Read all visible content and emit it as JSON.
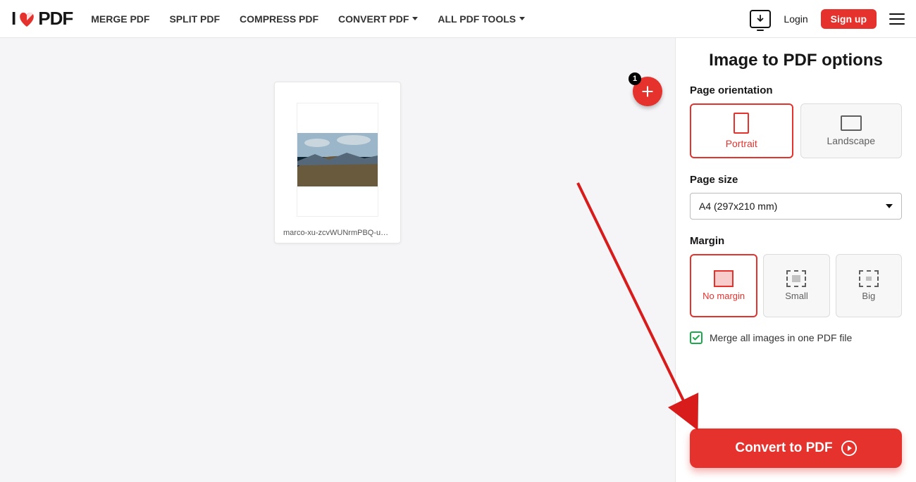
{
  "header": {
    "logo_left": "I",
    "logo_right": "PDF",
    "nav": {
      "merge": "MERGE PDF",
      "split": "SPLIT PDF",
      "compress": "COMPRESS PDF",
      "convert": "CONVERT PDF",
      "all": "ALL PDF TOOLS"
    },
    "login": "Login",
    "signup": "Sign up"
  },
  "workspace": {
    "add_badge": "1",
    "file_caption": "marco-xu-zcvWUNrmPBQ-unsp..."
  },
  "sidebar": {
    "title": "Image to PDF options",
    "orientation": {
      "label": "Page orientation",
      "portrait": "Portrait",
      "landscape": "Landscape",
      "selected": "portrait"
    },
    "page_size": {
      "label": "Page size",
      "value": "A4 (297x210 mm)"
    },
    "margin": {
      "label": "Margin",
      "none": "No margin",
      "small": "Small",
      "big": "Big",
      "selected": "none"
    },
    "merge": {
      "label": "Merge all images in one PDF file",
      "checked": true
    },
    "cta": "Convert to PDF"
  },
  "colors": {
    "accent": "#e5322d"
  }
}
